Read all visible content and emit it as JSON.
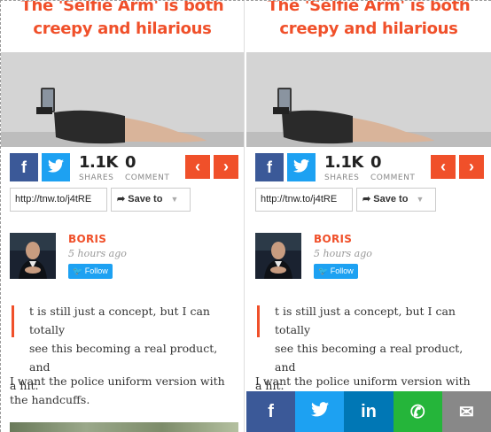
{
  "article": {
    "title_line1": "The 'Selfie Arm' is both",
    "title_line2": "creepy and hilarious"
  },
  "share": {
    "facebook_glyph": "f",
    "twitter_glyph": "🐦",
    "shares_count": "1.1K",
    "shares_label": "SHARES",
    "comments_count": "0",
    "comments_label": "COMMENT",
    "prev_glyph": "‹",
    "next_glyph": "›"
  },
  "link": {
    "short_url": "http://tnw.to/j4tRE",
    "save_label": "Save to",
    "save_icon": "share-arrow-icon"
  },
  "author": {
    "name": "BORIS",
    "time": "5 hours ago",
    "follow_label": "Follow"
  },
  "body": {
    "paragraph1_firstline": "t is still just a concept, but I can totally",
    "paragraph1_line2": "see this becoming a real product, and",
    "paragraph1_line3": "a hit.",
    "paragraph2": "I want the police uniform version with the handcuffs.",
    "paragraph2_right": "I want the police uniform version with the"
  },
  "floating_share": {
    "facebook": "f",
    "twitter": "🐦",
    "linkedin": "in",
    "whatsapp": "✆",
    "email": "✉"
  },
  "colors": {
    "accent": "#f0502a",
    "facebook": "#3b5998",
    "twitter": "#1da1f2",
    "linkedin": "#0077b5",
    "whatsapp": "#25b53a",
    "email": "#888888"
  }
}
